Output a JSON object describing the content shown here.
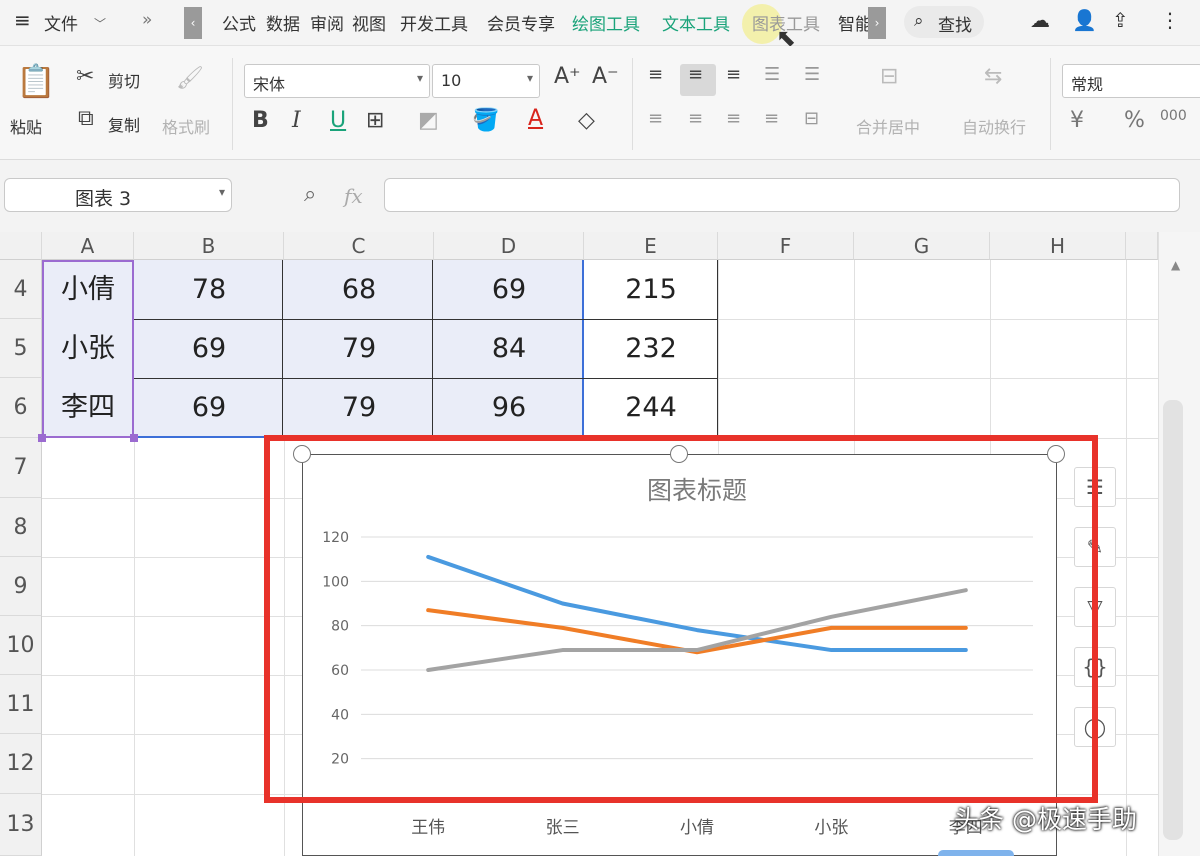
{
  "menu": {
    "file_label": "文件",
    "tabs": [
      "公式",
      "数据",
      "审阅",
      "视图",
      "开发工具",
      "会员专享",
      "绘图工具",
      "文本工具",
      "图表工具",
      "智能"
    ],
    "search_label": "查找"
  },
  "ribbon": {
    "paste": "粘贴",
    "cut": "剪切",
    "copy": "复制",
    "format_painter": "格式刷",
    "font_name": "宋体",
    "font_size": "10",
    "bold": "B",
    "italic": "I",
    "underline": "U",
    "font_color_glyph": "A",
    "merge_center": "合并居中",
    "wrap_text": "自动换行",
    "number_format": "常规"
  },
  "formula_bar": {
    "name_box": "图表 3",
    "fx": "fx",
    "value": ""
  },
  "grid": {
    "columns": [
      "A",
      "B",
      "C",
      "D",
      "E",
      "F",
      "G",
      "H"
    ],
    "rows": [
      {
        "num": "4",
        "cells": [
          "小倩",
          "78",
          "68",
          "69",
          "215"
        ]
      },
      {
        "num": "5",
        "cells": [
          "小张",
          "69",
          "79",
          "84",
          "232"
        ]
      },
      {
        "num": "6",
        "cells": [
          "李四",
          "69",
          "79",
          "96",
          "244"
        ]
      },
      {
        "num": "7"
      },
      {
        "num": "8"
      },
      {
        "num": "9"
      },
      {
        "num": "10"
      },
      {
        "num": "11"
      },
      {
        "num": "12"
      },
      {
        "num": "13"
      }
    ]
  },
  "chart_data": {
    "type": "line",
    "title": "图表标题",
    "categories": [
      "王伟",
      "张三",
      "小倩",
      "小张",
      "李四"
    ],
    "series": [
      {
        "color": "#4a9ae0",
        "values": [
          111,
          90,
          78,
          69,
          69
        ]
      },
      {
        "color": "#f07d26",
        "values": [
          87,
          79,
          68,
          79,
          79
        ]
      },
      {
        "color": "#a3a3a3",
        "values": [
          60,
          69,
          69,
          84,
          96
        ]
      }
    ],
    "yticks": [
      "120",
      "100",
      "80",
      "60",
      "40",
      "20"
    ],
    "ylim": [
      0,
      120
    ],
    "grid": true
  },
  "watermark": "头条 @极速手助"
}
